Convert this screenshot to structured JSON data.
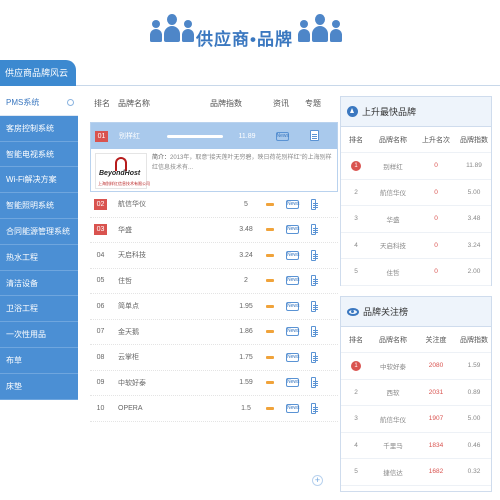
{
  "banner": {
    "title": "供应商•品牌"
  },
  "topbar": {
    "tab_label": "供应商品牌风云榜"
  },
  "sidebar": {
    "items": [
      {
        "label": "PMS系统",
        "active": true
      },
      {
        "label": "客房控制系统"
      },
      {
        "label": "智能电视系统"
      },
      {
        "label": "Wi-Fi解决方案"
      },
      {
        "label": "智能照明系统"
      },
      {
        "label": "合同能源管理系统"
      },
      {
        "label": "热水工程"
      },
      {
        "label": "清洁设备"
      },
      {
        "label": "卫浴工程"
      },
      {
        "label": "一次性用品"
      },
      {
        "label": "布草"
      },
      {
        "label": "床垫"
      }
    ]
  },
  "ranking": {
    "headers": {
      "rank": "排名",
      "name": "品牌名称",
      "index": "品牌指数",
      "news": "资讯",
      "report": "专题"
    },
    "featured": {
      "rank": "01",
      "name": "别样红",
      "index": "11.89",
      "news_label": "News",
      "logo_brand": "BeyondHost",
      "logo_cn": "上海别样红信息技术有限公司",
      "logo_en": "Shanghai BeyondHost Technology Co.,Ltd",
      "desc_label": "简介：",
      "desc_text": "2013年，取意\"接天莲叶无穷碧，映日荷花别样红\"的上海别样红信息技术有..."
    },
    "rows": [
      {
        "rank": "02",
        "name": "航信华仪",
        "index": "5",
        "top": true
      },
      {
        "rank": "03",
        "name": "华盛",
        "index": "3.48",
        "top": true
      },
      {
        "rank": "04",
        "name": "天启科技",
        "index": "3.24"
      },
      {
        "rank": "05",
        "name": "住哲",
        "index": "2"
      },
      {
        "rank": "06",
        "name": "简单点",
        "index": "1.95"
      },
      {
        "rank": "07",
        "name": "金天鹅",
        "index": "1.86"
      },
      {
        "rank": "08",
        "name": "云掌柜",
        "index": "1.75"
      },
      {
        "rank": "09",
        "name": "中软好泰",
        "index": "1.59"
      },
      {
        "rank": "10",
        "name": "OPERA",
        "index": "1.5"
      }
    ],
    "news_label": "News",
    "more": "+"
  },
  "rising": {
    "title": "上升最快品牌",
    "headers": {
      "rank": "排名",
      "name": "品牌名称",
      "delta": "上升名次",
      "index": "品牌指数"
    },
    "rows": [
      {
        "rank": "1",
        "name": "别样红",
        "delta": "0",
        "index": "11.89"
      },
      {
        "rank": "2",
        "name": "航信华仪",
        "delta": "0",
        "index": "5.00"
      },
      {
        "rank": "3",
        "name": "华盛",
        "delta": "0",
        "index": "3.48"
      },
      {
        "rank": "4",
        "name": "天启科技",
        "delta": "0",
        "index": "3.24"
      },
      {
        "rank": "5",
        "name": "住哲",
        "delta": "0",
        "index": "2.00"
      }
    ]
  },
  "attention": {
    "title": "品牌关注榜",
    "headers": {
      "rank": "排名",
      "name": "品牌名称",
      "attention": "关注度",
      "index": "品牌指数"
    },
    "rows": [
      {
        "rank": "1",
        "name": "中软好泰",
        "attention": "2080",
        "index": "1.59"
      },
      {
        "rank": "2",
        "name": "西软",
        "attention": "2031",
        "index": "0.89"
      },
      {
        "rank": "3",
        "name": "航信华仪",
        "attention": "1907",
        "index": "5.00"
      },
      {
        "rank": "4",
        "name": "千里马",
        "attention": "1834",
        "index": "0.46"
      },
      {
        "rank": "5",
        "name": "捷信达",
        "attention": "1682",
        "index": "0.32"
      }
    ]
  }
}
